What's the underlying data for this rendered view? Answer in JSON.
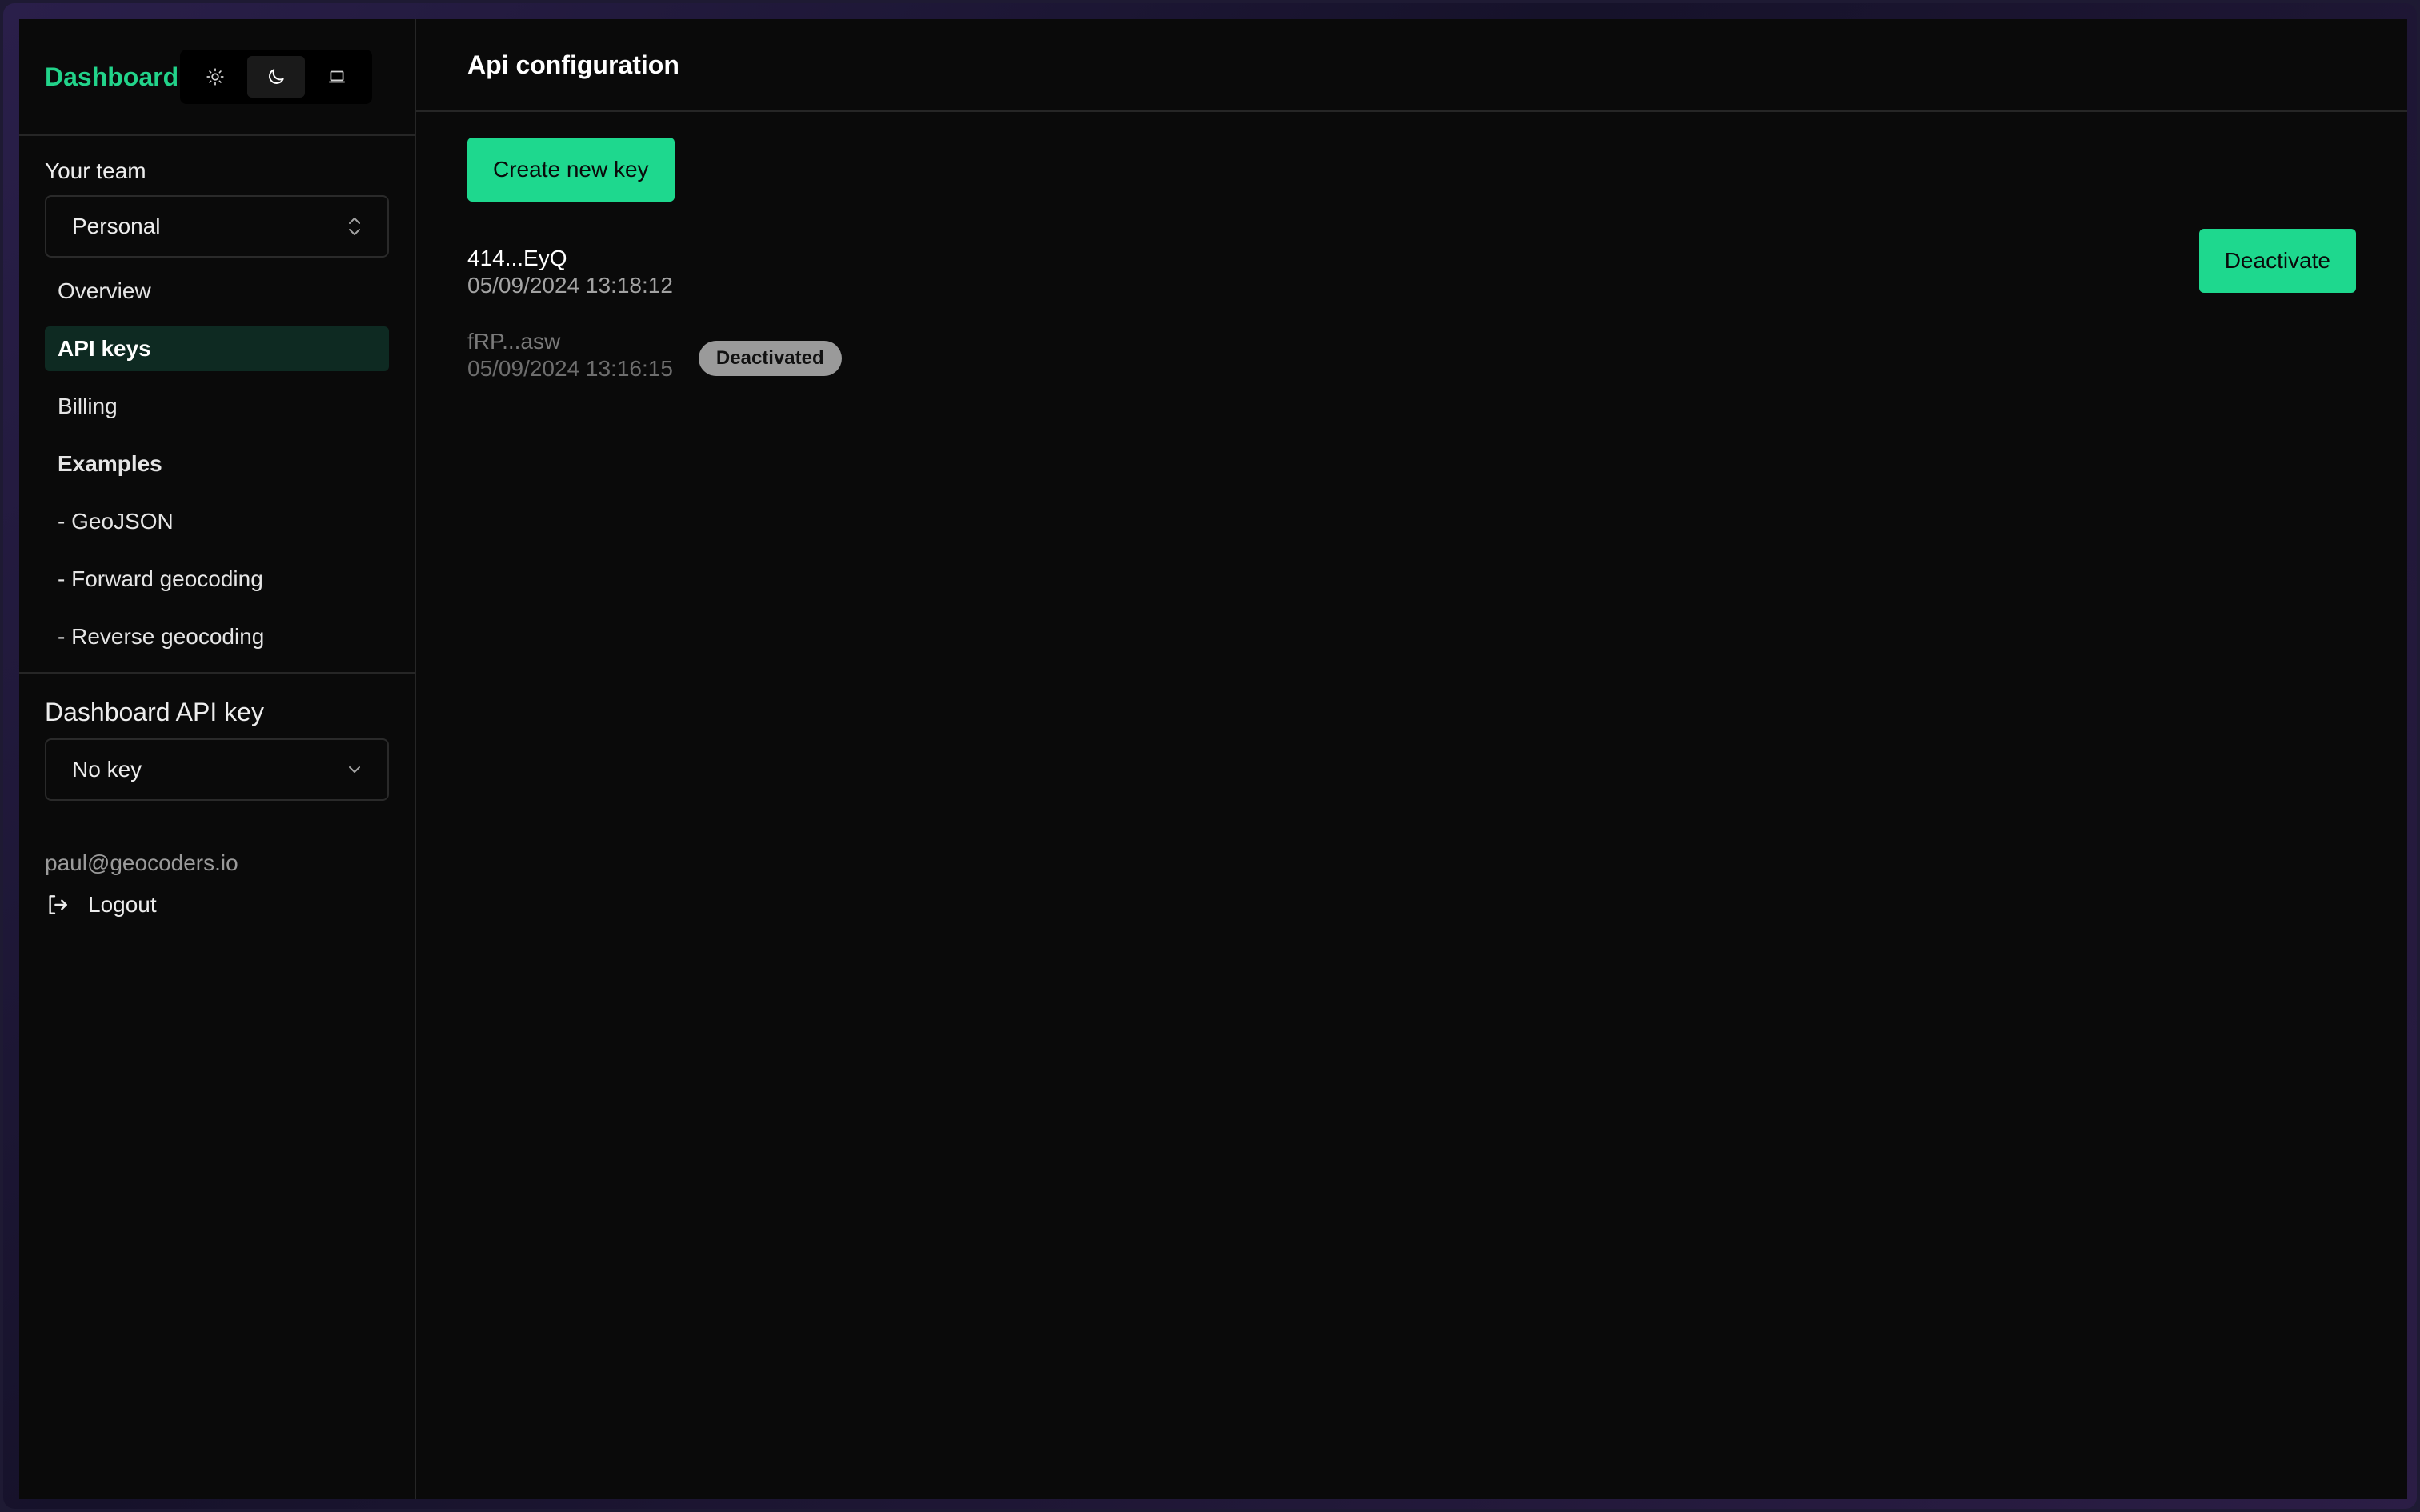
{
  "sidebar": {
    "brand": "Dashboard",
    "theme_options": [
      "light",
      "dark",
      "system"
    ],
    "active_theme": "dark",
    "team_label": "Your team",
    "team_value": "Personal",
    "nav": [
      {
        "label": "Overview"
      },
      {
        "label": "API keys"
      },
      {
        "label": "Billing"
      },
      {
        "label": "Examples"
      },
      {
        "label": "- GeoJSON"
      },
      {
        "label": "- Forward geocoding"
      },
      {
        "label": "- Reverse geocoding"
      }
    ],
    "api_key_label": "Dashboard API key",
    "api_key_value": "No key",
    "user_email": "paul@geocoders.io",
    "logout_label": "Logout"
  },
  "main": {
    "title": "Api configuration",
    "create_label": "Create new key",
    "keys": [
      {
        "name": "414...EyQ",
        "date": "05/09/2024 13:18:12",
        "action": "Deactivate"
      },
      {
        "name": "fRP...asw",
        "date": "05/09/2024 13:16:15",
        "badge": "Deactivated"
      }
    ]
  },
  "colors": {
    "accent": "#1ed88e",
    "background": "#0a0a0a",
    "active_nav_bg": "#0e2a22"
  }
}
